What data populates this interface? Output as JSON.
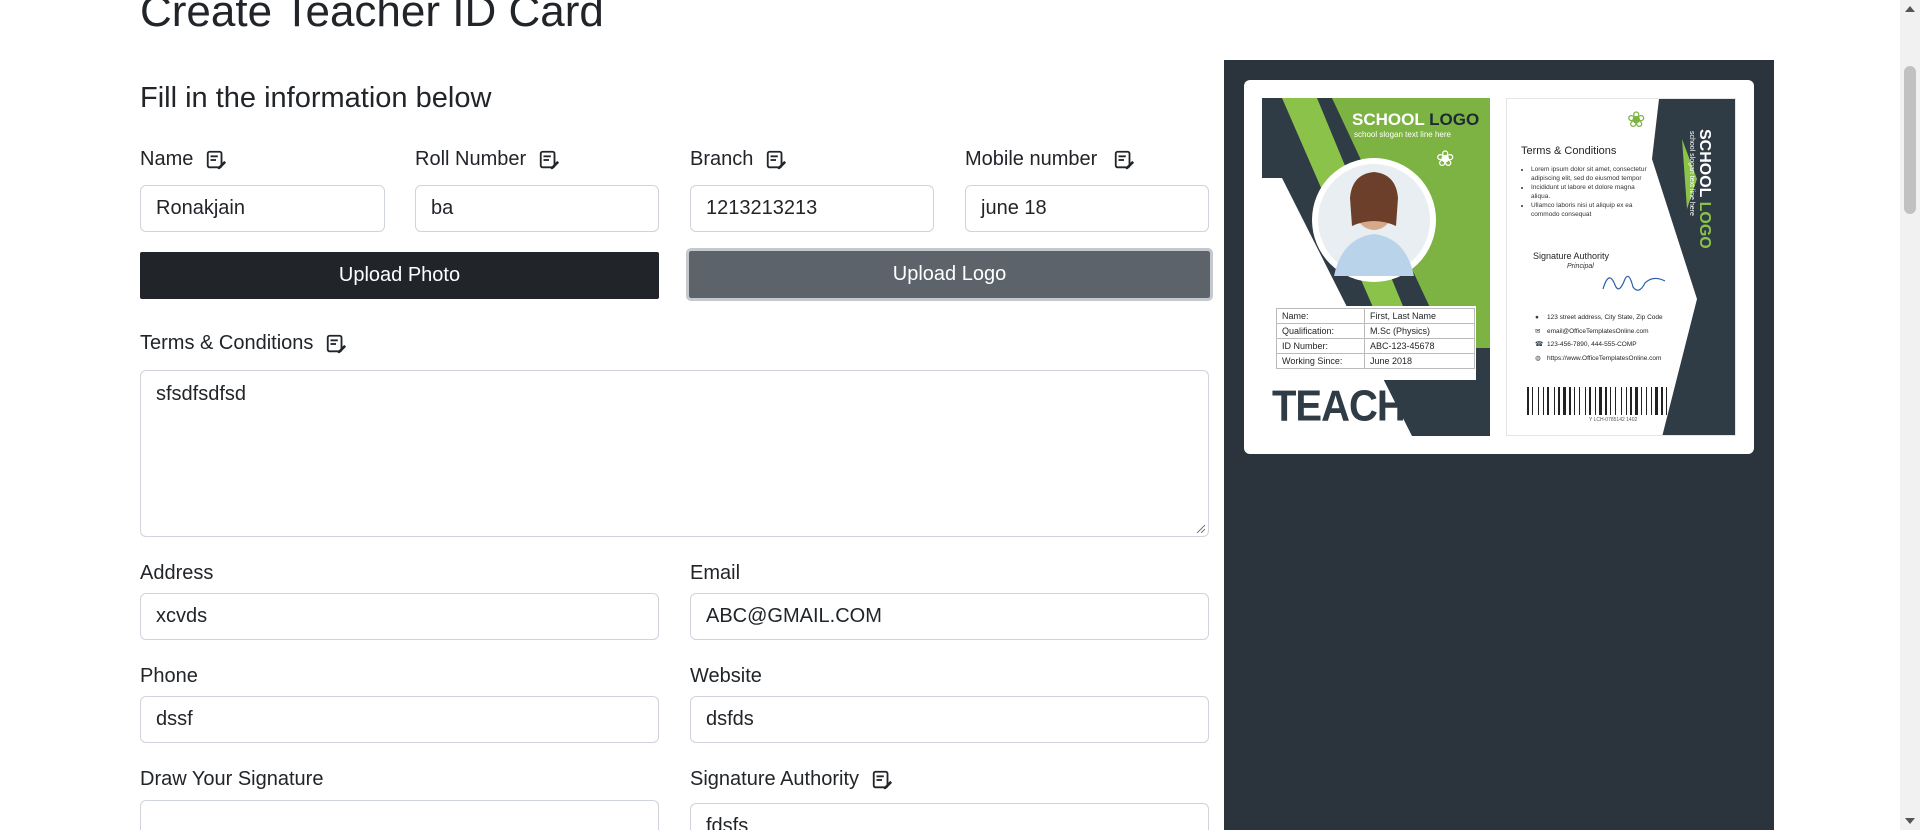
{
  "page": {
    "title": "Create Teacher ID Card",
    "subtitle": "Fill in the information below"
  },
  "form": {
    "name": {
      "label": "Name",
      "value": "Ronakjain"
    },
    "roll_number": {
      "label": "Roll Number",
      "value": "ba"
    },
    "branch": {
      "label": "Branch",
      "value": "1213213213"
    },
    "mobile": {
      "label": "Mobile number",
      "value": "june 18"
    },
    "upload_photo": "Upload Photo",
    "upload_logo": "Upload Logo",
    "terms": {
      "label": "Terms & Conditions",
      "value": "sfsdfsdfsd"
    },
    "address": {
      "label": "Address",
      "value": "xcvds"
    },
    "email": {
      "label": "Email",
      "value": "ABC@GMAIL.COM"
    },
    "phone": {
      "label": "Phone",
      "value": "dssf"
    },
    "website": {
      "label": "Website",
      "value": "dsfds"
    },
    "signature": {
      "label": "Draw Your Signature"
    },
    "signature_authority": {
      "label": "Signature Authority",
      "value": "fdsfs"
    }
  },
  "card": {
    "front": {
      "school_logo_a": "SCHOOL",
      "school_logo_b": "LOGO",
      "slogan": "school slogan text line here",
      "rows": [
        {
          "k": "Name:",
          "v": "First, Last Name"
        },
        {
          "k": "Qualification:",
          "v": "M.Sc (Physics)"
        },
        {
          "k": "ID Number:",
          "v": "ABC-123-45678"
        },
        {
          "k": "Working Since:",
          "v": "June 2018"
        }
      ],
      "role": "TEACHER"
    },
    "back": {
      "terms_title": "Terms & Conditions",
      "bullets": [
        "Lorem ipsum dolor sit amet, consectetur adipiscing elit, sed do eiusmod tempor",
        "Incididunt ut labore et dolore magna aliqua.",
        "Ullamco laboris nisi ut aliquip ex ea commodo consequat"
      ],
      "sig_title": "Signature Authority",
      "sig_sub": "Principal",
      "contacts": [
        "123 street address, City State, Zip Code",
        "email@OfficeTemplatesOnline.com",
        "123-456-7890, 444-555-COMP",
        "https://www.OfficeTemplatesOnline.com"
      ],
      "vertical_a": "SCHOOL",
      "vertical_b": "LOGO",
      "vertical_slogan": "school slogan text line here",
      "barcode_text": "Y LCH-0785142 1402"
    },
    "colors": {
      "green": "#7cb342",
      "dark": "#2f3b45"
    }
  }
}
